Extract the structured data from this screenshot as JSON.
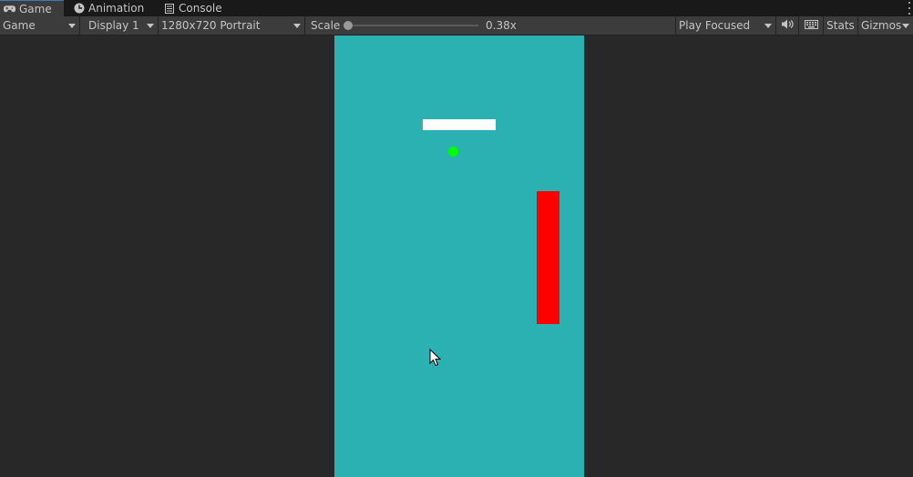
{
  "tabs": [
    {
      "label": "Game",
      "icon": "gamepad-icon",
      "active": true
    },
    {
      "label": "Animation",
      "icon": "clock-icon",
      "active": false
    },
    {
      "label": "Console",
      "icon": "console-icon",
      "active": false
    }
  ],
  "toolbar": {
    "view_mode": "Game",
    "display": "Display 1",
    "resolution": "1280x720 Portrait",
    "scale_label": "Scale",
    "scale_value": "0.38x",
    "scale_level": 0.38,
    "play_mode": "Play Focused",
    "audio_icon": "speaker-icon",
    "keyboard_icon": "keyboard-icon",
    "stats_label": "Stats",
    "gizmos_label": "Gizmos"
  },
  "game": {
    "background_color": "#2bb1b2",
    "paddle_color": "#ffffff",
    "ball_color": "#00ff00",
    "block_color": "#ff0000"
  },
  "colors": {
    "editor_bg": "#282828",
    "toolbar_bg": "#3c3c3c",
    "tabbar_bg": "#191919",
    "active_tab_accent": "#3a79bb"
  }
}
